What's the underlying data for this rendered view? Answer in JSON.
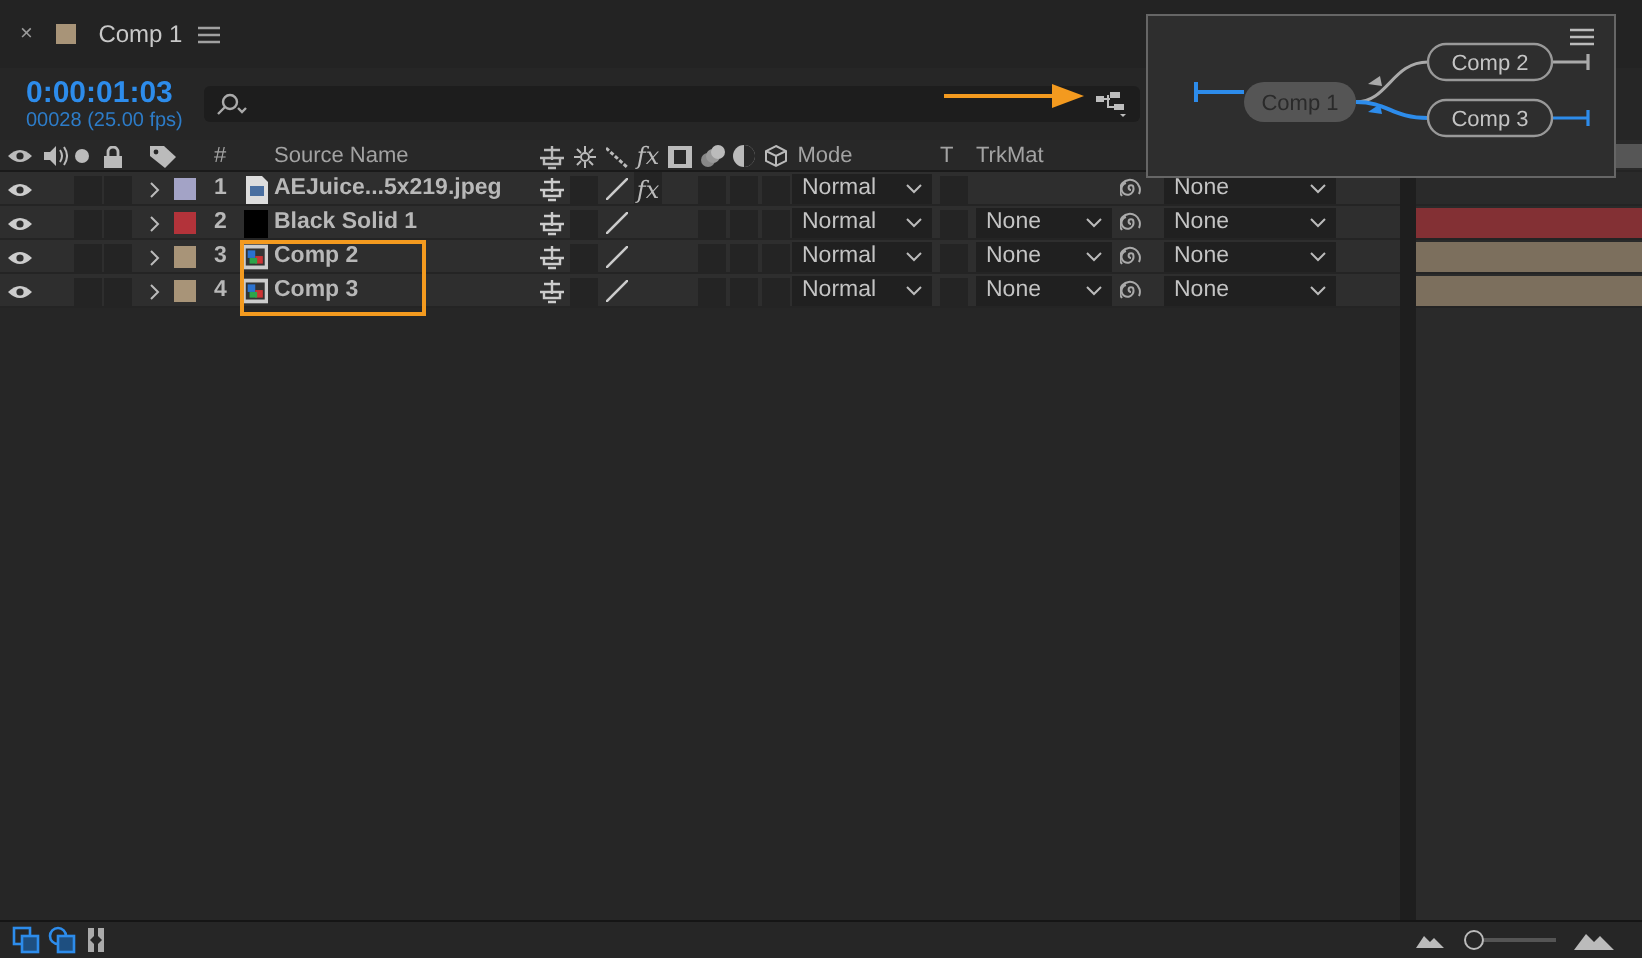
{
  "tab": {
    "close": "×",
    "title": "Comp 1",
    "color": "#a89478"
  },
  "timecode": "0:00:01:03",
  "frame_info": "00028 (25.00 fps)",
  "columns": {
    "number": "#",
    "source_name": "Source Name",
    "fx": "fx",
    "mode": "Mode",
    "t": "T",
    "trkmat": "TrkMat"
  },
  "layers": [
    {
      "number": "1",
      "name": "AEJuice...5x219.jpeg",
      "kind": "image",
      "color": "#a3a3c6",
      "fx": "fx",
      "mode": "Normal",
      "parent": "None",
      "bar": false
    },
    {
      "number": "2",
      "name": "Black Solid 1",
      "kind": "solid",
      "color": "#b3333a",
      "mode": "Normal",
      "trkmat": "None",
      "parent": "None",
      "bar": true
    },
    {
      "number": "3",
      "name": "Comp 2",
      "kind": "comp",
      "color": "#a89478",
      "mode": "Normal",
      "trkmat": "None",
      "parent": "None",
      "bar": true
    },
    {
      "number": "4",
      "name": "Comp 3",
      "kind": "comp",
      "color": "#a89478",
      "mode": "Normal",
      "trkmat": "None",
      "parent": "None",
      "bar": true
    }
  ],
  "zoom_slider": {
    "level": 0
  },
  "flowchart": {
    "root": "Comp 1",
    "children": [
      {
        "label": "Comp 2",
        "active": false
      },
      {
        "label": "Comp 3",
        "active": true
      }
    ]
  }
}
